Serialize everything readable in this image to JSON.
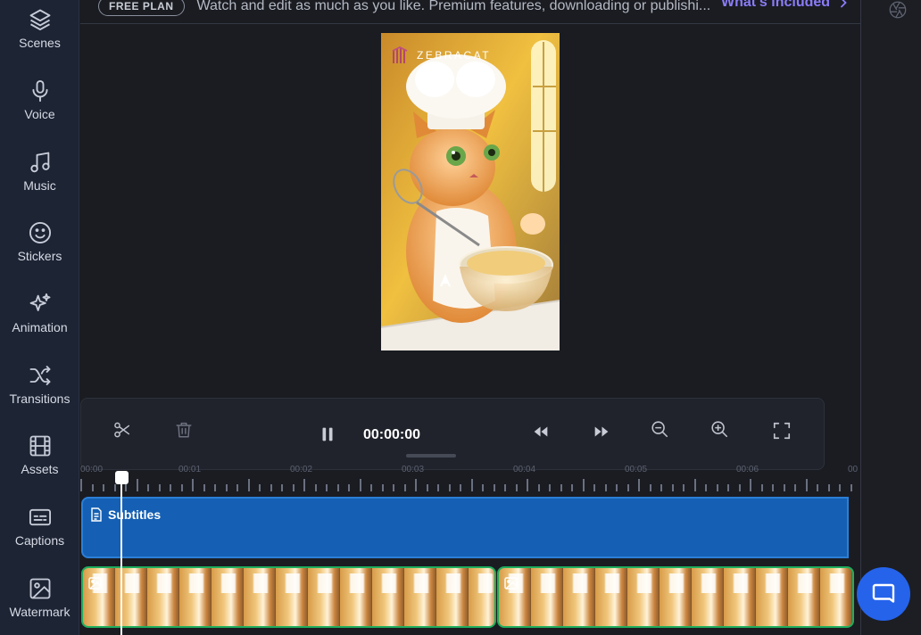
{
  "sidebar": {
    "items": [
      {
        "label": "Scenes",
        "icon": "layers-icon"
      },
      {
        "label": "Voice",
        "icon": "microphone-icon"
      },
      {
        "label": "Music",
        "icon": "music-note-icon"
      },
      {
        "label": "Stickers",
        "icon": "smiley-icon"
      },
      {
        "label": "Animation",
        "icon": "sparkles-icon"
      },
      {
        "label": "Transitions",
        "icon": "shuffle-icon"
      },
      {
        "label": "Assets",
        "icon": "film-icon"
      },
      {
        "label": "Captions",
        "icon": "captions-icon"
      },
      {
        "label": "Watermark",
        "icon": "image-icon"
      }
    ]
  },
  "banner": {
    "plan": "FREE PLAN",
    "message": "Watch and edit as much as you like. Premium features, downloading or publishi...",
    "link": "What's included"
  },
  "preview": {
    "brand": "ZEBRACAT"
  },
  "controls": {
    "timecode": "00:00:00",
    "icons": [
      "scissors-icon",
      "trash-icon",
      "pause-icon",
      "rewind-icon",
      "fast-forward-icon",
      "zoom-out-icon",
      "zoom-in-icon",
      "fullscreen-icon"
    ]
  },
  "timeline": {
    "ruler_labels": [
      "00:00",
      "00:01",
      "00:02",
      "00:03",
      "00:04",
      "00:05",
      "00:06",
      "00"
    ],
    "subtitle_track_label": "Subtitles"
  },
  "colors": {
    "accent": "#8b7cf8",
    "subtitle_track": "#1560b4",
    "clip_border": "#1fae5e",
    "chat": "#2563eb"
  }
}
